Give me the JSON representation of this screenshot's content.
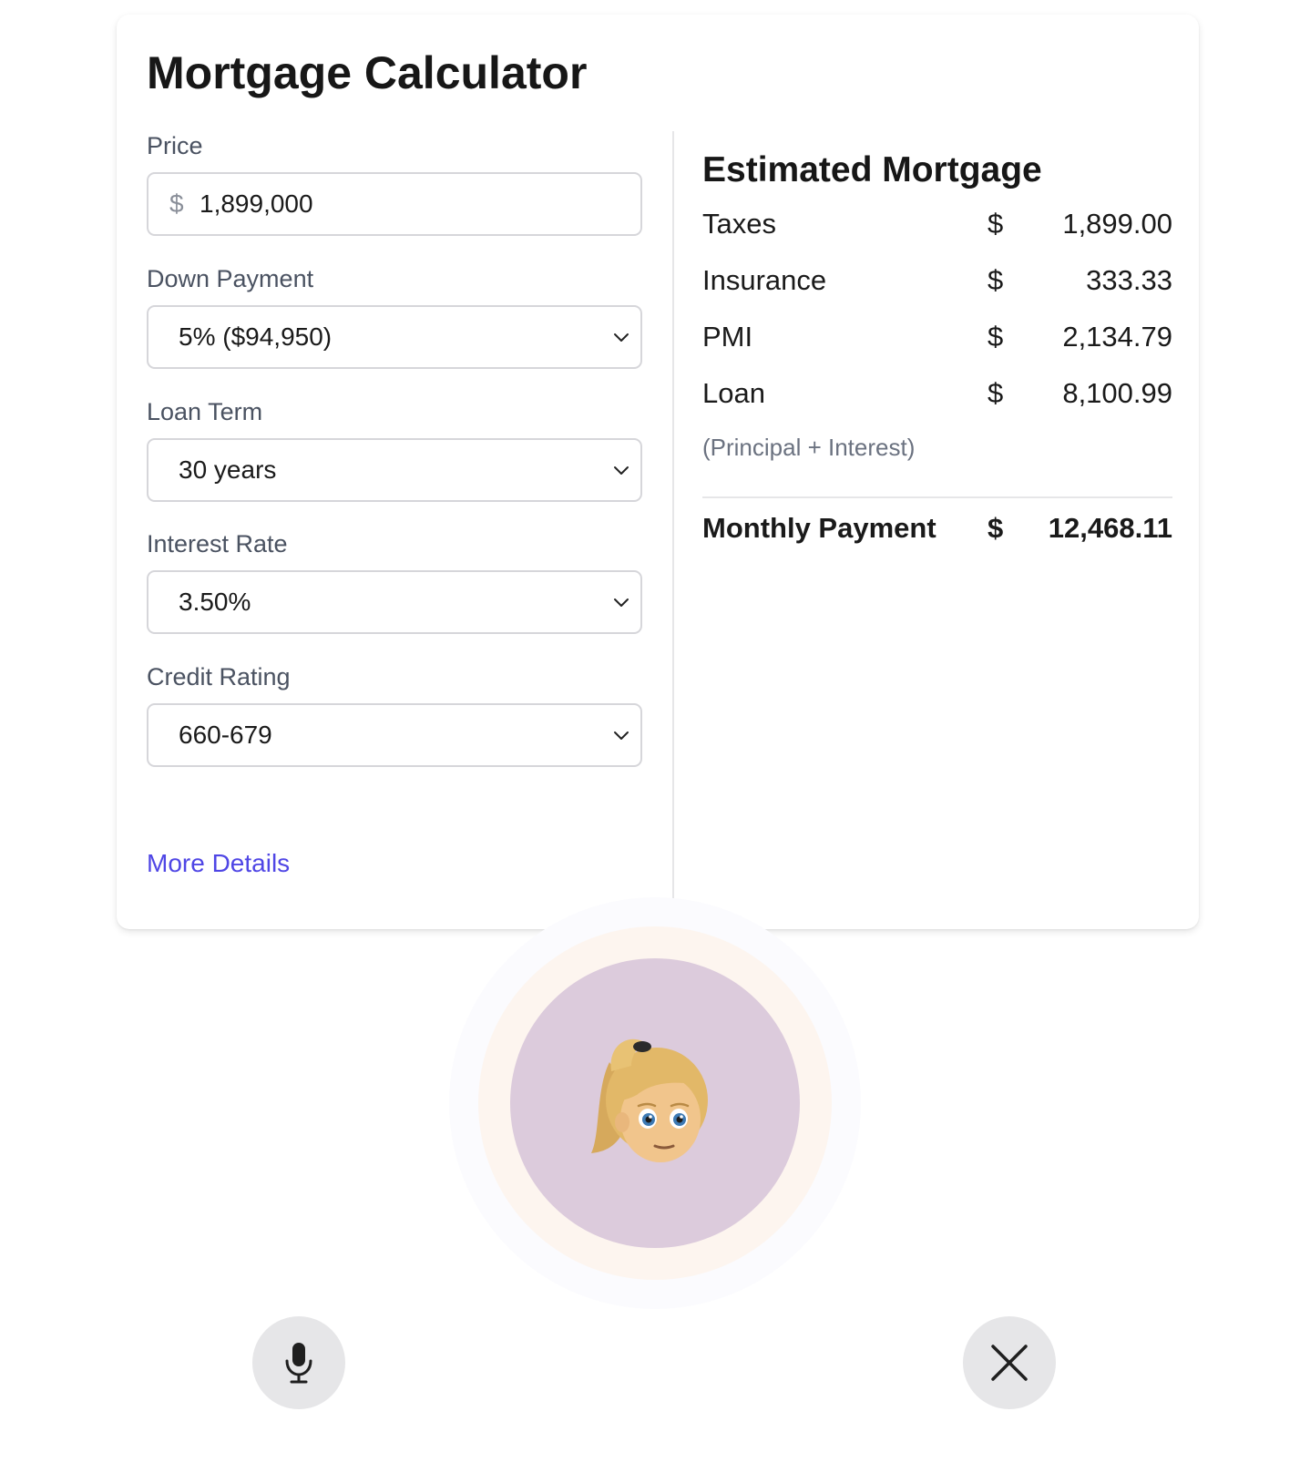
{
  "calculator": {
    "title": "Mortgage Calculator",
    "price": {
      "label": "Price",
      "currency_symbol": "$",
      "value": "1,899,000"
    },
    "down_payment": {
      "label": "Down Payment",
      "selected": "5% ($94,950)"
    },
    "loan_term": {
      "label": "Loan Term",
      "selected": "30 years"
    },
    "interest_rate": {
      "label": "Interest Rate",
      "selected": "3.50%"
    },
    "credit_rating": {
      "label": "Credit Rating",
      "selected": "660-679"
    },
    "more_details_link": "More Details"
  },
  "estimate": {
    "title": "Estimated Mortgage",
    "rows": [
      {
        "label": "Taxes",
        "currency": "$",
        "amount": "1,899.00"
      },
      {
        "label": "Insurance",
        "currency": "$",
        "amount": "333.33"
      },
      {
        "label": "PMI",
        "currency": "$",
        "amount": "2,134.79"
      },
      {
        "label": "Loan",
        "currency": "$",
        "amount": "8,100.99"
      }
    ],
    "loan_note": "(Principal + Interest)",
    "total": {
      "label": "Monthly Payment",
      "currency": "$",
      "amount": "12,468.11"
    }
  },
  "assistant": {
    "avatar_icon": "woman-blond-hair-emoji",
    "avatar_background": "#dccbdc"
  },
  "controls": {
    "mic_icon": "microphone-icon",
    "close_icon": "close-icon"
  },
  "colors": {
    "link": "#4f46e5",
    "label": "#4a5261",
    "border": "#d6d6da"
  }
}
